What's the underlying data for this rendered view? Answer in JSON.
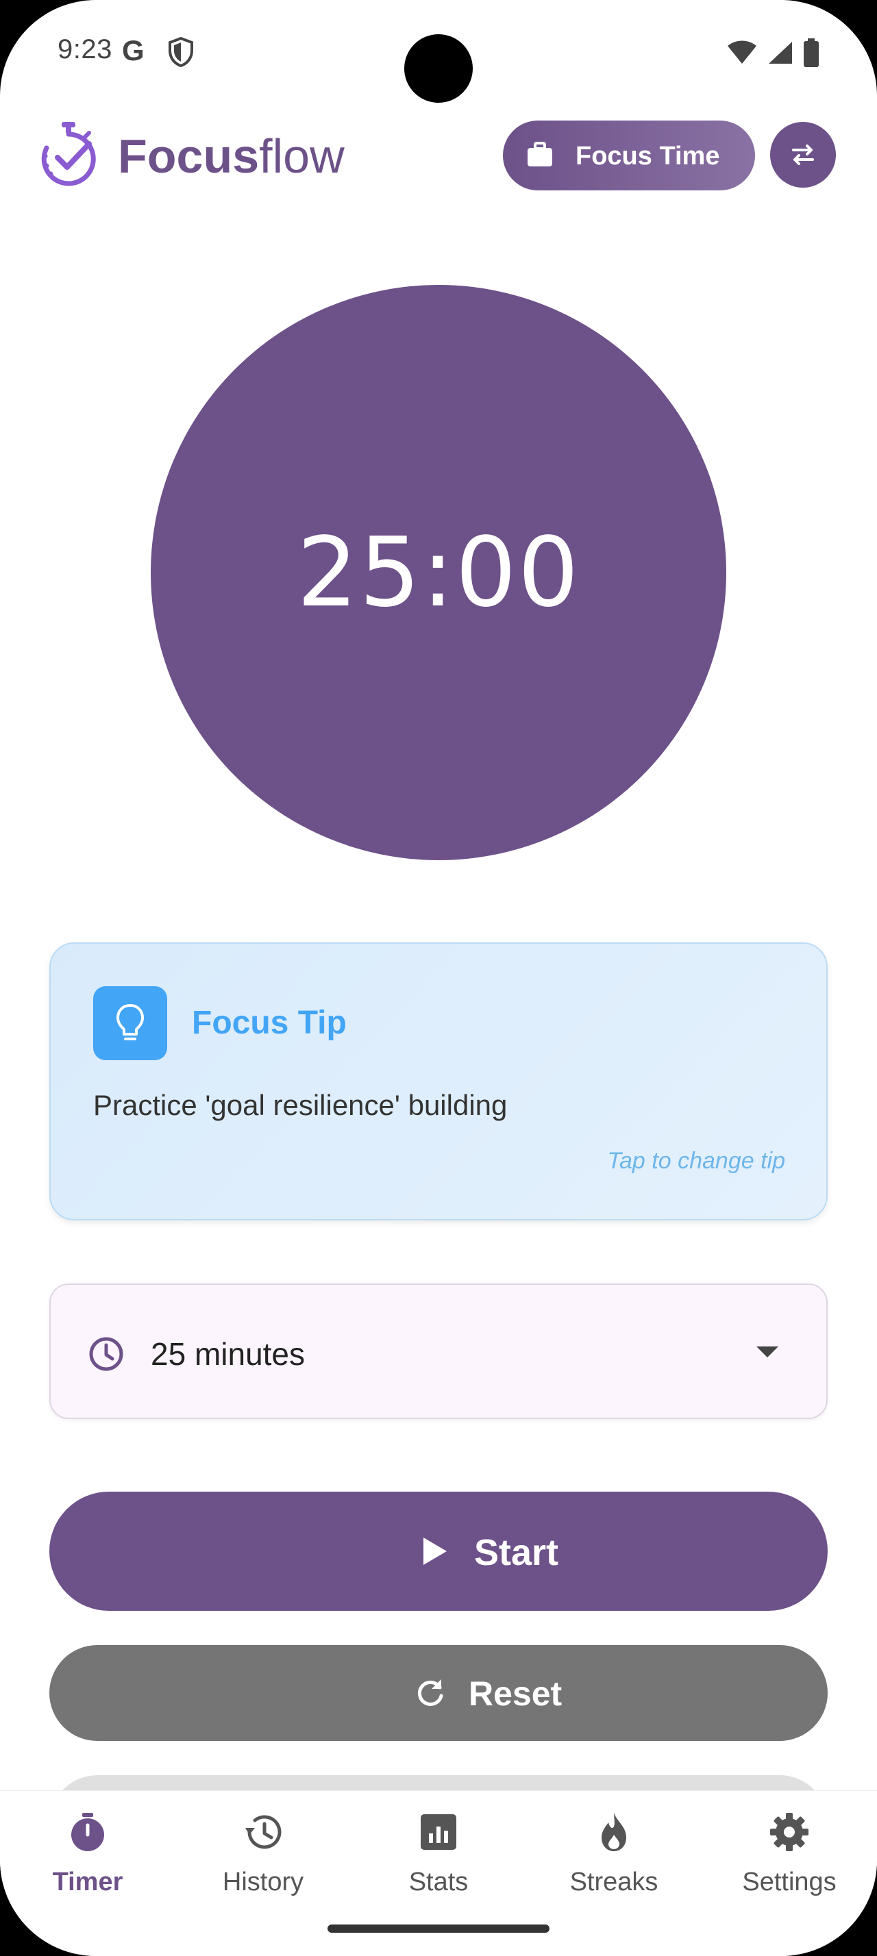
{
  "status_bar": {
    "time": "9:23",
    "left_icons": [
      "google-icon",
      "shield-icon"
    ],
    "right_icons": [
      "wifi-icon",
      "cell-signal-icon",
      "battery-icon"
    ]
  },
  "app_bar": {
    "logo_strong": "Focus",
    "logo_light": "flow",
    "mode_label": "Focus Time",
    "mode_icon": "briefcase-icon",
    "swap_icon": "swap-icon"
  },
  "timer": {
    "display": "25:00"
  },
  "tip": {
    "title": "Focus Tip",
    "body": "Practice 'goal resilience' building",
    "hint": "Tap to change tip",
    "icon": "lightbulb-icon"
  },
  "duration": {
    "selected": "25 minutes",
    "icon": "clock-icon"
  },
  "actions": {
    "start_label": "Start",
    "reset_label": "Reset"
  },
  "nav": {
    "items": [
      {
        "label": "Timer",
        "icon": "timer-icon",
        "active": true
      },
      {
        "label": "History",
        "icon": "history-icon",
        "active": false
      },
      {
        "label": "Stats",
        "icon": "stats-icon",
        "active": false
      },
      {
        "label": "Streaks",
        "icon": "flame-icon",
        "active": false
      },
      {
        "label": "Settings",
        "icon": "gear-icon",
        "active": false
      }
    ]
  },
  "colors": {
    "primary": "#6d5189",
    "tip_accent": "#42a5f5",
    "reset_gray": "#757575"
  }
}
